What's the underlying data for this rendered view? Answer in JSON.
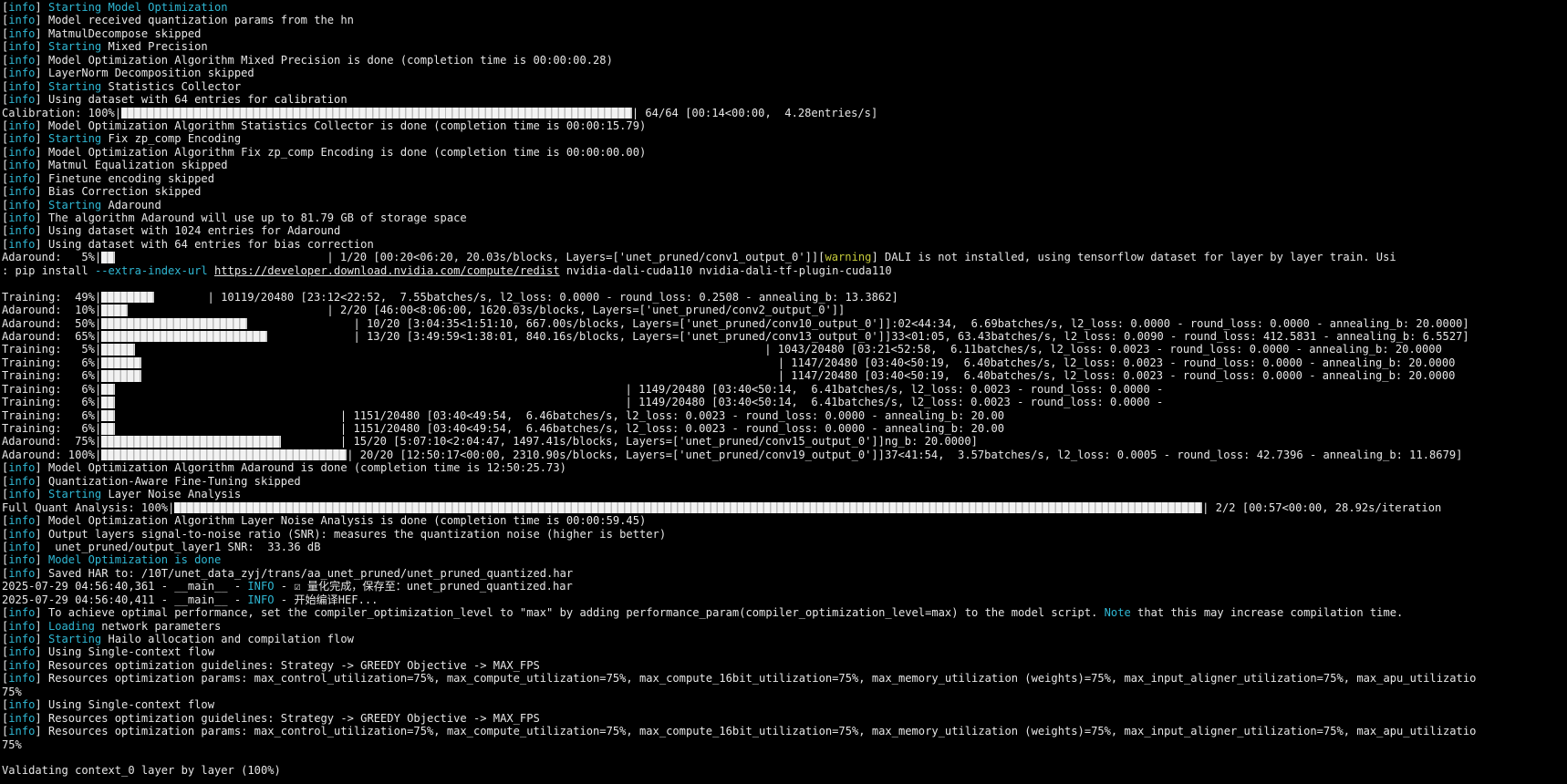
{
  "lines": [
    {
      "t": "log",
      "parts": [
        [
          "Starting Model Optimization",
          "info"
        ]
      ]
    },
    {
      "t": "log",
      "parts": [
        [
          "Model received quantization params from the hn",
          ""
        ]
      ]
    },
    {
      "t": "log",
      "parts": [
        [
          "MatmulDecompose skipped",
          ""
        ]
      ]
    },
    {
      "t": "log",
      "parts": [
        [
          "Starting",
          "info"
        ],
        [
          " Mixed Precision",
          ""
        ]
      ]
    },
    {
      "t": "log",
      "parts": [
        [
          "Model Optimization Algorithm Mixed Precision is done (completion time is 00:00:00.28)",
          ""
        ]
      ]
    },
    {
      "t": "log",
      "parts": [
        [
          "LayerNorm Decomposition skipped",
          ""
        ]
      ]
    },
    {
      "t": "log",
      "parts": [
        [
          "Starting",
          "info"
        ],
        [
          " Statistics Collector",
          ""
        ]
      ]
    },
    {
      "t": "log",
      "parts": [
        [
          "Using dataset with 64 entries for calibration",
          ""
        ]
      ]
    },
    {
      "t": "bar",
      "pre": "Calibration: 100%|",
      "bar": 77,
      "pad": 0,
      "post": "| 64/64 [00:14<00:00,  4.28entries/s]"
    },
    {
      "t": "log",
      "parts": [
        [
          "Model Optimization Algorithm Statistics Collector is done (completion time is 00:00:15.79)",
          ""
        ]
      ]
    },
    {
      "t": "log",
      "parts": [
        [
          "Starting",
          "info"
        ],
        [
          " Fix zp_comp Encoding",
          ""
        ]
      ]
    },
    {
      "t": "log",
      "parts": [
        [
          "Model Optimization Algorithm Fix zp_comp Encoding is done (completion time is 00:00:00.00)",
          ""
        ]
      ]
    },
    {
      "t": "log",
      "parts": [
        [
          "Matmul Equalization skipped",
          ""
        ]
      ]
    },
    {
      "t": "log",
      "parts": [
        [
          "Finetune encoding skipped",
          ""
        ]
      ]
    },
    {
      "t": "log",
      "parts": [
        [
          "Bias Correction skipped",
          ""
        ]
      ]
    },
    {
      "t": "log",
      "parts": [
        [
          "Starting",
          "info"
        ],
        [
          " Adaround",
          ""
        ]
      ]
    },
    {
      "t": "log",
      "parts": [
        [
          "The algorithm Adaround will use up to 81.79 GB of storage space",
          ""
        ]
      ]
    },
    {
      "t": "log",
      "parts": [
        [
          "Using dataset with 1024 entries for Adaround",
          ""
        ]
      ]
    },
    {
      "t": "log",
      "parts": [
        [
          "Using dataset with 64 entries for bias correction",
          ""
        ]
      ]
    },
    {
      "t": "bar",
      "pre": "Adaround:   5%|",
      "bar": 2,
      "pad": 32,
      "post": "| 1/20 [00:20<06:20, 20.03s/blocks, Layers=['unet_pruned/conv1_output_0']][",
      "post2": "warning",
      "post3": "] DALI is not installed, using tensorflow dataset for layer by layer train. Usi"
    },
    {
      "t": "raw",
      "parts": [
        [
          ": pip install ",
          ""
        ],
        [
          "--extra-index-url",
          "info"
        ],
        [
          " ",
          ""
        ],
        [
          "https://developer.download.nvidia.com/compute/redist",
          "link"
        ],
        [
          " nvidia-dali-cuda110 nvidia-dali-tf-plugin-cuda110",
          ""
        ]
      ]
    },
    {
      "t": "raw",
      "parts": [
        [
          "",
          ""
        ]
      ]
    },
    {
      "t": "bar",
      "pre": "Training:  49%|",
      "bar": 8,
      "pad": 8,
      "post": "| 10119/20480 [23:12<22:52,  7.55batches/s, l2_loss: 0.0000 - round_loss: 0.2508 - annealing_b: 13.3862]"
    },
    {
      "t": "bar",
      "pre": "Adaround:  10%|",
      "bar": 4,
      "pad": 30,
      "post": "| 2/20 [46:00<8:06:00, 1620.03s/blocks, Layers=['unet_pruned/conv2_output_0']]"
    },
    {
      "t": "bar",
      "pre": "Adaround:  50%|",
      "bar": 22,
      "pad": 16,
      "post": "| 10/20 [3:04:35<1:51:10, 667.00s/blocks, Layers=['unet_pruned/conv10_output_0']]:02<44:34,  6.69batches/s, l2_loss: 0.0000 - round_loss: 0.0000 - annealing_b: 20.0000]"
    },
    {
      "t": "bar",
      "pre": "Adaround:  65%|",
      "bar": 25,
      "pad": 13,
      "post": "| 13/20 [3:49:59<1:38:01, 840.16s/blocks, Layers=['unet_pruned/conv13_output_0']]33<01:05, 63.43batches/s, l2_loss: 0.0090 - round_loss: 412.5831 - annealing_b: 6.5527]"
    },
    {
      "t": "bar",
      "pre": "Training:   5%|",
      "bar": 5,
      "pad": 95,
      "post": "| 1043/20480 [03:21<52:58,  6.11batches/s, l2_loss: 0.0023 - round_loss: 0.0000 - annealing_b: 20.0000"
    },
    {
      "t": "bar",
      "pre": "Training:   6%|",
      "bar": 6,
      "pad": 96,
      "post": "| 1147/20480 [03:40<50:19,  6.40batches/s, l2_loss: 0.0023 - round_loss: 0.0000 - annealing_b: 20.0000"
    },
    {
      "t": "bar",
      "pre": "Training:   6%|",
      "bar": 6,
      "pad": 96,
      "post": "| 1147/20480 [03:40<50:19,  6.40batches/s, l2_loss: 0.0023 - round_loss: 0.0000 - annealing_b: 20.0000"
    },
    {
      "t": "bar",
      "pre": "Training:   6%|",
      "bar": 2,
      "pad": 77,
      "post": "| 1149/20480 [03:40<50:14,  6.41batches/s, l2_loss: 0.0023 - round_loss: 0.0000 -"
    },
    {
      "t": "bar",
      "pre": "Training:   6%|",
      "bar": 2,
      "pad": 77,
      "post": "| 1149/20480 [03:40<50:14,  6.41batches/s, l2_loss: 0.0023 - round_loss: 0.0000 -"
    },
    {
      "t": "bar",
      "pre": "Training:   6%|",
      "bar": 2,
      "pad": 34,
      "post": "| 1151/20480 [03:40<49:54,  6.46batches/s, l2_loss: 0.0023 - round_loss: 0.0000 - annealing_b: 20.00"
    },
    {
      "t": "bar",
      "pre": "Training:   6%|",
      "bar": 2,
      "pad": 34,
      "post": "| 1151/20480 [03:40<49:54,  6.46batches/s, l2_loss: 0.0023 - round_loss: 0.0000 - annealing_b: 20.00"
    },
    {
      "t": "bar",
      "pre": "Adaround:  75%|",
      "bar": 27,
      "pad": 9,
      "post": "| 15/20 [5:07:10<2:04:47, 1497.41s/blocks, Layers=['unet_pruned/conv15_output_0']]ng_b: 20.0000]"
    },
    {
      "t": "bar",
      "pre": "Adaround: 100%|",
      "bar": 37,
      "pad": 0,
      "post": "| 20/20 [12:50:17<00:00, 2310.90s/blocks, Layers=['unet_pruned/conv19_output_0']]37<41:54,  3.57batches/s, l2_loss: 0.0005 - round_loss: 42.7396 - annealing_b: 11.8679]"
    },
    {
      "t": "log",
      "parts": [
        [
          "Model Optimization Algorithm Adaround is done (completion time is 12:50:25.73)",
          ""
        ]
      ]
    },
    {
      "t": "log",
      "parts": [
        [
          "Quantization-Aware Fine-Tuning skipped",
          ""
        ]
      ]
    },
    {
      "t": "log",
      "parts": [
        [
          "Starting",
          "info"
        ],
        [
          " Layer Noise Analysis",
          ""
        ]
      ]
    },
    {
      "t": "bar",
      "pre": "Full Quant Analysis: 100%|",
      "bar": 155,
      "pad": 0,
      "post": "| 2/2 [00:57<00:00, 28.92s/iteration"
    },
    {
      "t": "log",
      "parts": [
        [
          "Model Optimization Algorithm Layer Noise Analysis is done (completion time is 00:00:59.45)",
          ""
        ]
      ]
    },
    {
      "t": "log",
      "parts": [
        [
          "Output layers signal-to-noise ratio (SNR): measures the quantization noise (higher is better)",
          ""
        ]
      ]
    },
    {
      "t": "log",
      "parts": [
        [
          " unet_pruned/output_layer1 SNR:  33.36 dB",
          ""
        ]
      ]
    },
    {
      "t": "log",
      "parts": [
        [
          "Model Optimization is done",
          "info"
        ]
      ]
    },
    {
      "t": "log",
      "parts": [
        [
          "Saved HAR to: /10T/unet_data_zyj/trans/aa_unet_pruned/unet_pruned_quantized.har",
          ""
        ]
      ]
    },
    {
      "t": "raw",
      "parts": [
        [
          "2025-07-29 04:56:40,361 - __main__ - ",
          ""
        ],
        [
          "INFO",
          "info"
        ],
        [
          " - ☑ 量化完成，保存至：unet_pruned_quantized.har",
          ""
        ]
      ]
    },
    {
      "t": "raw",
      "parts": [
        [
          "2025-07-29 04:56:40,411 - __main__ - ",
          ""
        ],
        [
          "INFO",
          "info"
        ],
        [
          " - 开始编译HEF...",
          ""
        ]
      ]
    },
    {
      "t": "log",
      "parts": [
        [
          "To achieve optimal performance, set the compiler_optimization_level to \"max\" by adding performance_param(compiler_optimization_level=max) to the model script. ",
          ""
        ],
        [
          "Note",
          "info"
        ],
        [
          " that this may increase compilation time.",
          ""
        ]
      ]
    },
    {
      "t": "log",
      "parts": [
        [
          "Loading",
          "info"
        ],
        [
          " network parameters",
          ""
        ]
      ]
    },
    {
      "t": "log",
      "parts": [
        [
          "Starting",
          "info"
        ],
        [
          " Hailo allocation and compilation flow",
          ""
        ]
      ]
    },
    {
      "t": "log",
      "parts": [
        [
          "Using Single-context flow",
          ""
        ]
      ]
    },
    {
      "t": "log",
      "parts": [
        [
          "Resources optimization guidelines: Strategy -> GREEDY Objective -> MAX_FPS",
          ""
        ]
      ]
    },
    {
      "t": "log",
      "parts": [
        [
          "Resources optimization params: max_control_utilization=75%, max_compute_utilization=75%, max_compute_16bit_utilization=75%, max_memory_utilization (weights)=75%, max_input_aligner_utilization=75%, max_apu_utilizatio",
          ""
        ]
      ]
    },
    {
      "t": "raw",
      "parts": [
        [
          "75%",
          ""
        ]
      ]
    },
    {
      "t": "log",
      "parts": [
        [
          "Using Single-context flow",
          ""
        ]
      ]
    },
    {
      "t": "log",
      "parts": [
        [
          "Resources optimization guidelines: Strategy -> GREEDY Objective -> MAX_FPS",
          ""
        ]
      ]
    },
    {
      "t": "log",
      "parts": [
        [
          "Resources optimization params: max_control_utilization=75%, max_compute_utilization=75%, max_compute_16bit_utilization=75%, max_memory_utilization (weights)=75%, max_input_aligner_utilization=75%, max_apu_utilizatio",
          ""
        ]
      ]
    },
    {
      "t": "raw",
      "parts": [
        [
          "75%",
          ""
        ]
      ]
    },
    {
      "t": "raw",
      "parts": [
        [
          "",
          ""
        ]
      ]
    },
    {
      "t": "raw",
      "parts": [
        [
          "Validating context_0 layer by layer (100%)",
          ""
        ]
      ]
    }
  ],
  "colors": {
    "background": "#000000",
    "foreground": "#e6e6e6",
    "info": "#2fb7d3",
    "warning": "#c4c93a"
  }
}
